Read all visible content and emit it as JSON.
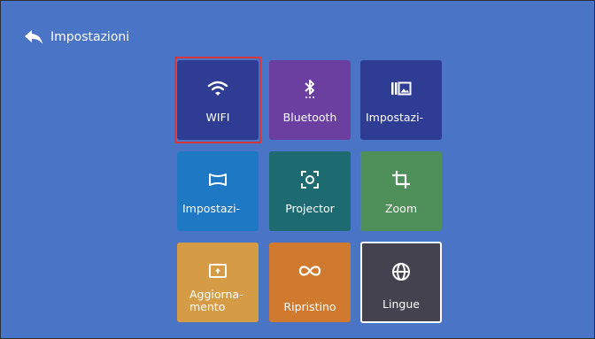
{
  "header": {
    "title": "Impostazioni",
    "back_icon": "back-arrow-icon"
  },
  "colors": {
    "background": "#4a74c6",
    "focus_ring": "#d9353a",
    "wifi": "#2e3d93",
    "bluetooth": "#6b3fa0",
    "image_settings": "#2e3d93",
    "keystone": "#1f78c3",
    "projector": "#1d6b70",
    "zoom": "#4f8f5a",
    "update": "#d59b45",
    "reset": "#cf7a2e",
    "language": "#44424f"
  },
  "tiles": [
    {
      "label": "WIFI",
      "icon": "wifi-icon",
      "focused": true
    },
    {
      "label": "Bluetooth",
      "icon": "bluetooth-icon"
    },
    {
      "label": "Impostazi-",
      "icon": "image-settings-icon"
    },
    {
      "label": "Impostazi-",
      "icon": "keystone-icon"
    },
    {
      "label": "Projector",
      "icon": "projector-mode-icon"
    },
    {
      "label": "Zoom",
      "icon": "crop-icon"
    },
    {
      "label": "Aggiorna- mento",
      "icon": "update-icon"
    },
    {
      "label": "Ripristino",
      "icon": "infinity-icon"
    },
    {
      "label": "Lingue",
      "icon": "globe-icon",
      "selected": true
    }
  ]
}
